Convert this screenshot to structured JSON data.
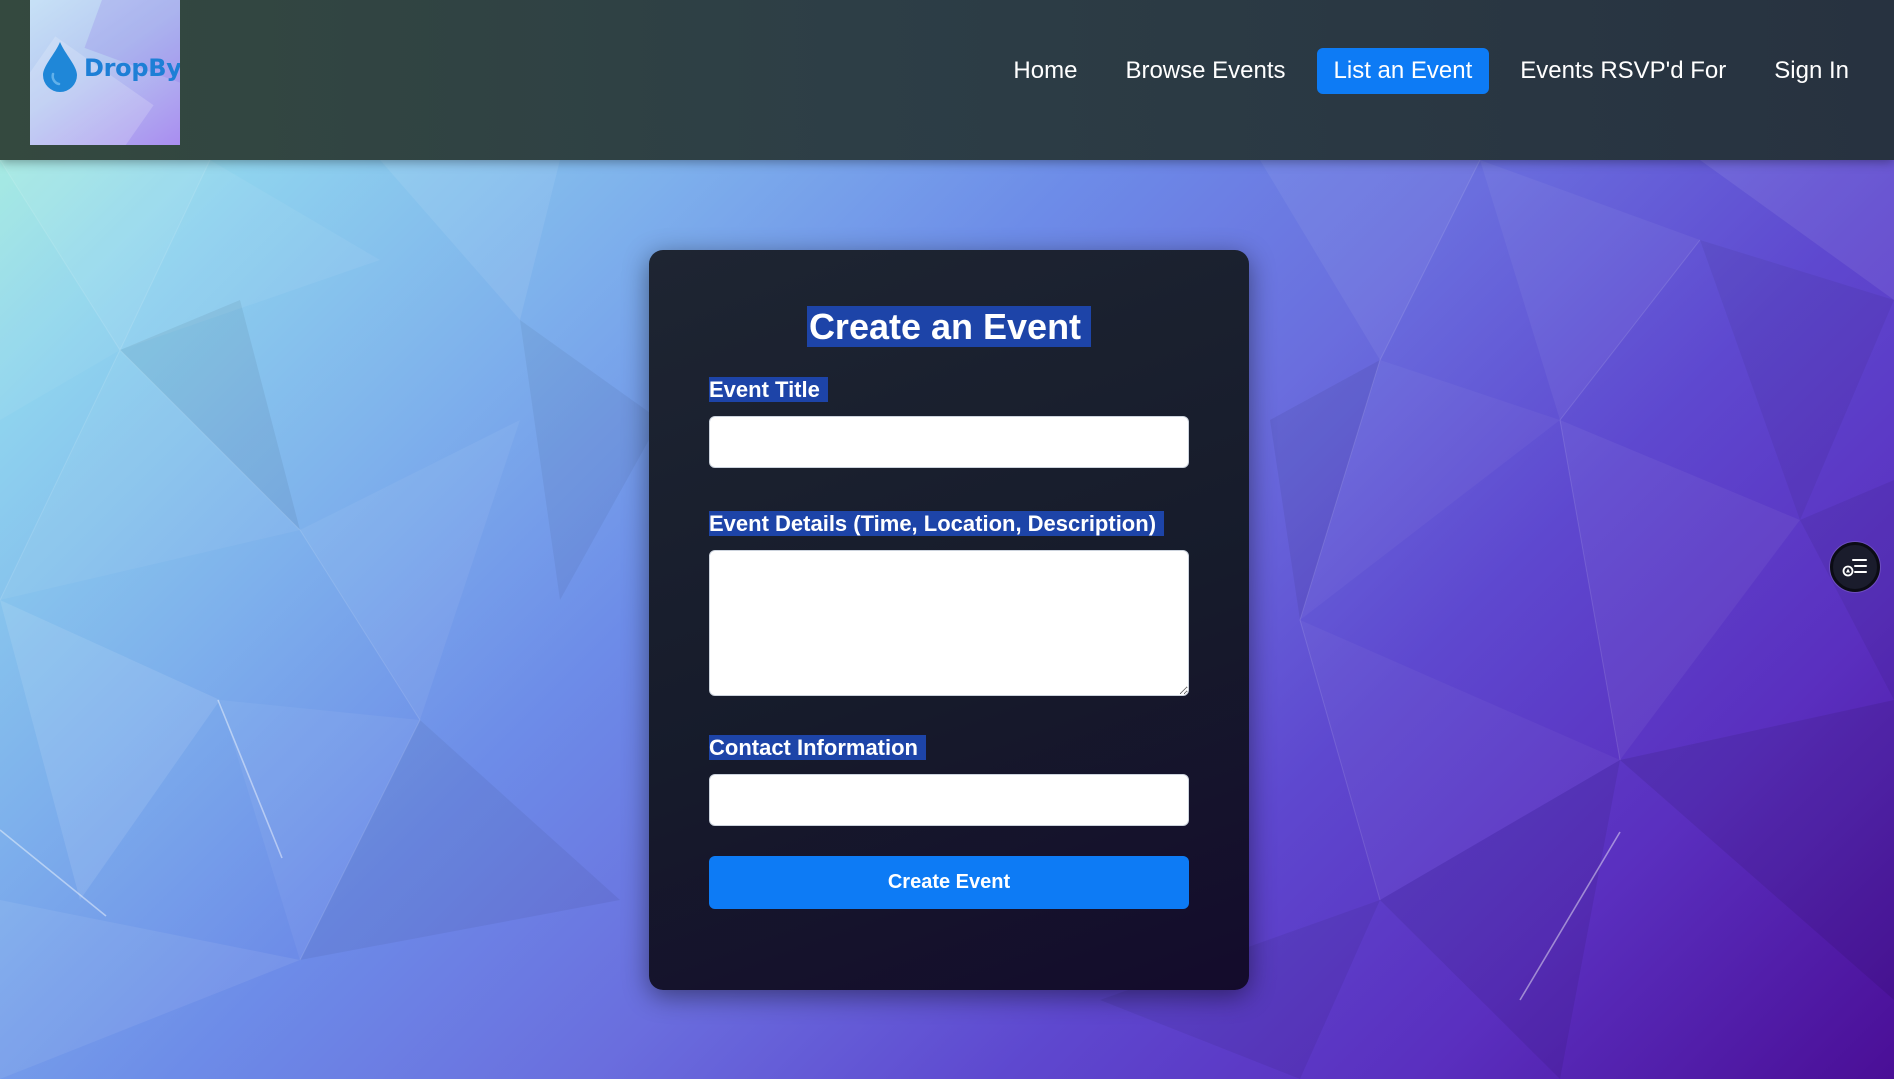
{
  "brand": {
    "name": "DropBy",
    "logo_icon": "water-drop-icon",
    "color": "#1d7fd6"
  },
  "nav": {
    "items": [
      {
        "label": "Home",
        "active": false
      },
      {
        "label": "Browse Events",
        "active": false
      },
      {
        "label": "List an Event",
        "active": true
      },
      {
        "label": "Events RSVP'd For",
        "active": false
      },
      {
        "label": "Sign In",
        "active": false
      }
    ],
    "active_color": "#0d7bf5"
  },
  "form": {
    "title": "Create an Event",
    "event_title_label": "Event Title",
    "event_title_value": "",
    "details_label": "Event Details (Time, Location, Description)",
    "details_value": "",
    "contact_label": "Contact Information",
    "contact_value": "",
    "submit_label": "Create Event"
  },
  "floating_button": {
    "icon": "reader-list-icon"
  },
  "colors": {
    "selection": "#1d44a8",
    "card": "#181d2c",
    "accent": "#0d7bf5"
  }
}
